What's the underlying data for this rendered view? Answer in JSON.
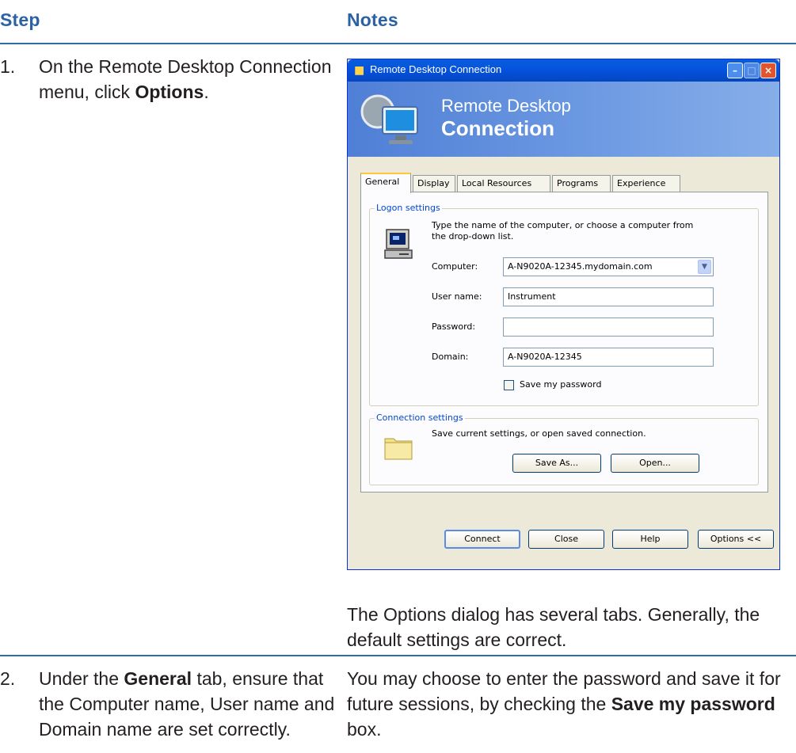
{
  "headers": {
    "step": "Step",
    "notes": "Notes"
  },
  "step1": {
    "number": "1.",
    "text_before": "On the Remote Desktop Connection menu, click ",
    "bold": "Options",
    "text_after": "."
  },
  "notes1": "The Options dialog has several tabs. Generally, the default settings are correct.",
  "step2": {
    "number": "2.",
    "text_before": "Under the ",
    "bold": "General",
    "text_after": " tab, ensure that the Computer name, User name and Domain name are set correctly."
  },
  "notes2": {
    "text_before": "You may choose to enter the password and save it for future sessions, by checking the ",
    "bold": "Save my password",
    "text_after": " box."
  },
  "dialog": {
    "title": "Remote Desktop Connection",
    "banner_line1": "Remote Desktop",
    "banner_line2": "Connection",
    "tabs": [
      "General",
      "Display",
      "Local Resources",
      "Programs",
      "Experience"
    ],
    "active_tab": "General",
    "logon_group": "Logon settings",
    "logon_desc_1": "Type the name of the computer, or choose a computer from",
    "logon_desc_2": "the drop-down list.",
    "computer_label": "Computer:",
    "computer_value": "A-N9020A-12345.mydomain.com",
    "username_label": "User name:",
    "username_value": "Instrument",
    "password_label": "Password:",
    "password_value": "",
    "domain_label": "Domain:",
    "domain_value": "A-N9020A-12345",
    "save_password_label": "Save my password",
    "save_password_checked": false,
    "connection_group": "Connection settings",
    "connection_desc": "Save current settings, or open saved connection.",
    "save_as": "Save As...",
    "open": "Open...",
    "connect": "Connect",
    "close": "Close",
    "help": "Help",
    "options": "Options <<"
  },
  "colors": {
    "header_blue": "#2b62a6",
    "rule_blue": "#2d6fa4",
    "xp_title_blue": "#0554e0",
    "group_title_blue": "#0046d5"
  },
  "icons": [
    "remote-desktop-icon",
    "computer-icon",
    "folder-icon",
    "minimize-icon",
    "maximize-icon",
    "close-icon",
    "dropdown-arrow-icon"
  ]
}
